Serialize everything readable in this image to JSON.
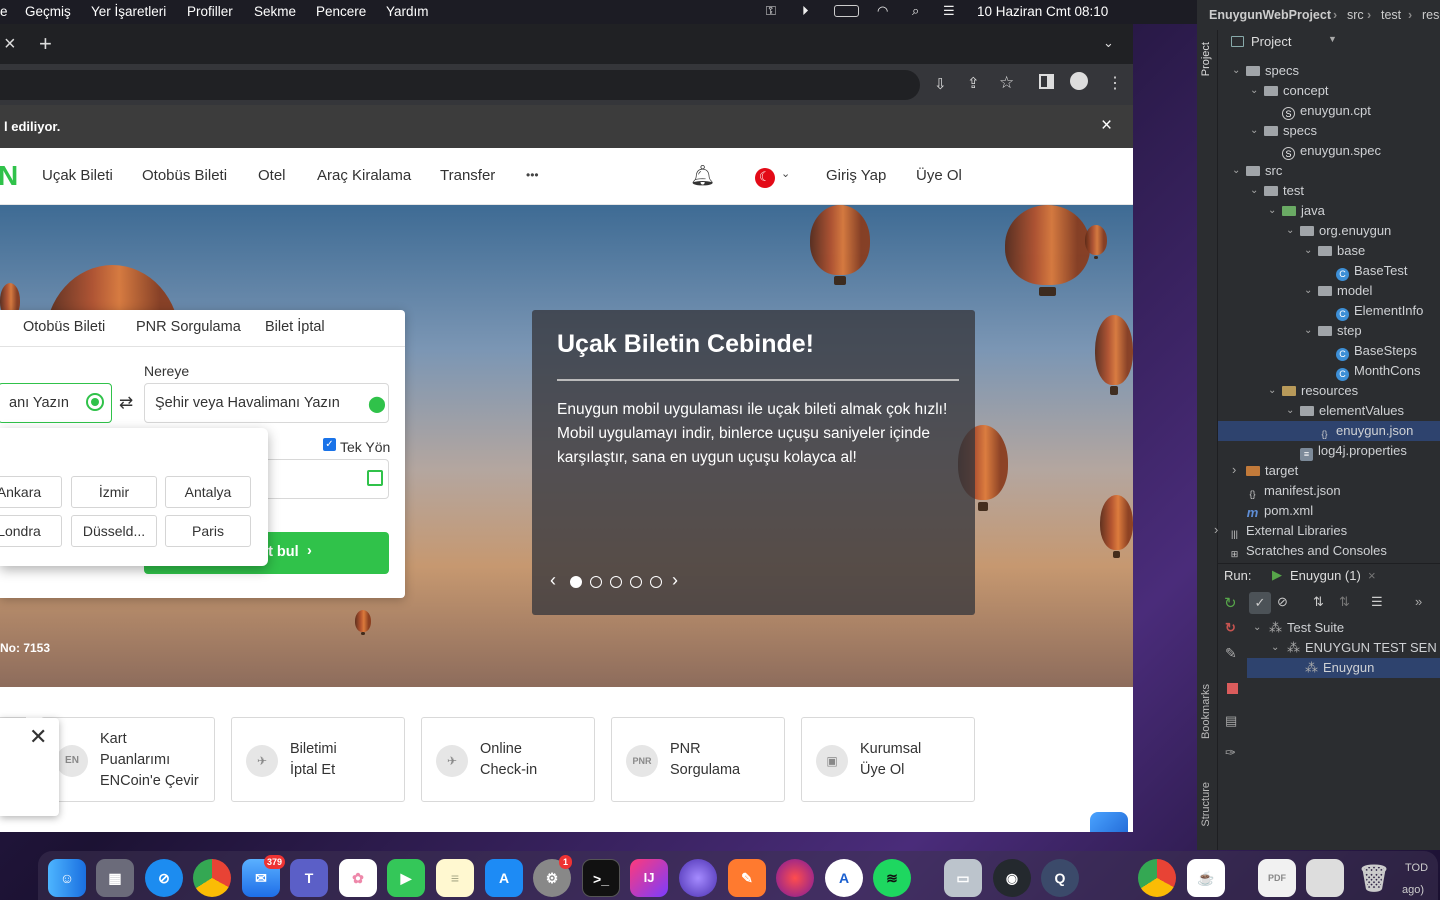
{
  "menubar": {
    "items": [
      "e",
      "Geçmiş",
      "Yer İşaretleri",
      "Profiller",
      "Sekme",
      "Pencere",
      "Yardım"
    ],
    "datetime": "10 Haziran Cmt  08:10"
  },
  "browser": {
    "new_tab": "+",
    "close_tab": "×",
    "info_text": "l ediliyor.",
    "info_close": "×"
  },
  "site": {
    "logo": "N",
    "nav": [
      "Uçak Bileti",
      "Otobüs Bileti",
      "Otel",
      "Araç Kiralama",
      "Transfer"
    ],
    "more": "•••",
    "login": "Giriş Yap",
    "signup": "Üye Ol"
  },
  "search": {
    "tabs": [
      "Otobüs Bileti",
      "PNR Sorgulama",
      "Bilet İptal"
    ],
    "from_value": "anı Yazın",
    "to_label": "Nereye",
    "to_placeholder": "Şehir veya Havalimanı Yazın",
    "oneway_label": "Tek Yön",
    "cities": [
      "Ankara",
      "İzmir",
      "Antalya",
      "Londra",
      "Düsseld...",
      "Paris"
    ],
    "find_button": "et bul",
    "support_no": "No: 7153"
  },
  "promo": {
    "title": "Uçak Biletin Cebinde!",
    "body": "Enuygun mobil uygulaması ile uçak bileti almak çok hızlı! Mobil uygulamayı indir, binlerce uçuşu saniyeler içinde karşılaştır, sana en uygun uçuşu kolayca al!",
    "active_slide": 1,
    "slide_count": 5
  },
  "services": [
    {
      "lines": [
        "Kart",
        "Puanlarımı",
        "ENCoin'e Çevir"
      ],
      "icon": "EN"
    },
    {
      "lines": [
        "Biletimi",
        "İptal Et"
      ],
      "icon": "✈"
    },
    {
      "lines": [
        "Online",
        "Check-in"
      ],
      "icon": "✈"
    },
    {
      "lines": [
        "PNR",
        "Sorgulama"
      ],
      "icon": "PNR"
    },
    {
      "lines": [
        "Kurumsal",
        "Üye Ol"
      ],
      "icon": "▣"
    }
  ],
  "dock": {
    "mail_badge": "379",
    "settings_badge": "1",
    "intellij_label": "IJ"
  },
  "ide": {
    "breadcrumb": [
      "EnuygunWebProject",
      "src",
      "test",
      "reso"
    ],
    "panel_title": "Project",
    "tree": [
      {
        "label": "specs",
        "indent": 1,
        "kind": "folder",
        "open": true
      },
      {
        "label": "concept",
        "indent": 2,
        "kind": "folder",
        "open": true
      },
      {
        "label": "enuygun.cpt",
        "indent": 3,
        "kind": "spec"
      },
      {
        "label": "specs",
        "indent": 2,
        "kind": "folder",
        "open": true
      },
      {
        "label": "enuygun.spec",
        "indent": 3,
        "kind": "spec"
      },
      {
        "label": "src",
        "indent": 1,
        "kind": "folder",
        "open": true
      },
      {
        "label": "test",
        "indent": 2,
        "kind": "folder",
        "open": true
      },
      {
        "label": "java",
        "indent": 3,
        "kind": "folder-green",
        "open": true
      },
      {
        "label": "org.enuygun",
        "indent": 4,
        "kind": "pkg",
        "open": true
      },
      {
        "label": "base",
        "indent": 5,
        "kind": "pkg",
        "open": true
      },
      {
        "label": "BaseTest",
        "indent": 6,
        "kind": "class"
      },
      {
        "label": "model",
        "indent": 5,
        "kind": "pkg",
        "open": true
      },
      {
        "label": "ElementInfo",
        "indent": 6,
        "kind": "class"
      },
      {
        "label": "step",
        "indent": 5,
        "kind": "pkg",
        "open": true
      },
      {
        "label": "BaseSteps",
        "indent": 6,
        "kind": "class"
      },
      {
        "label": "MonthCons",
        "indent": 6,
        "kind": "class"
      },
      {
        "label": "resources",
        "indent": 3,
        "kind": "folder-res",
        "open": true
      },
      {
        "label": "elementValues",
        "indent": 4,
        "kind": "folder",
        "open": true
      },
      {
        "label": "enuygun.json",
        "indent": 5,
        "kind": "json",
        "selected": true
      },
      {
        "label": "log4j.properties",
        "indent": 4,
        "kind": "props"
      },
      {
        "label": "target",
        "indent": 1,
        "kind": "folder-orange",
        "open": false
      },
      {
        "label": "manifest.json",
        "indent": 1,
        "kind": "json"
      },
      {
        "label": "pom.xml",
        "indent": 1,
        "kind": "maven"
      },
      {
        "label": "External Libraries",
        "indent": 0,
        "kind": "lib",
        "open": false
      },
      {
        "label": "Scratches and Consoles",
        "indent": 0,
        "kind": "scratch"
      }
    ],
    "run_label": "Run:",
    "run_tab": "Enuygun (1)",
    "run_tree": [
      {
        "label": "Test Suite",
        "indent": 0
      },
      {
        "label": "ENUYGUN TEST SEN",
        "indent": 1
      },
      {
        "label": "Enuygun",
        "indent": 2,
        "selected": true
      }
    ],
    "side_labels": [
      "Project",
      "Bookmarks",
      "Structure"
    ],
    "bottom_text": [
      "TOD",
      "ago)"
    ]
  }
}
